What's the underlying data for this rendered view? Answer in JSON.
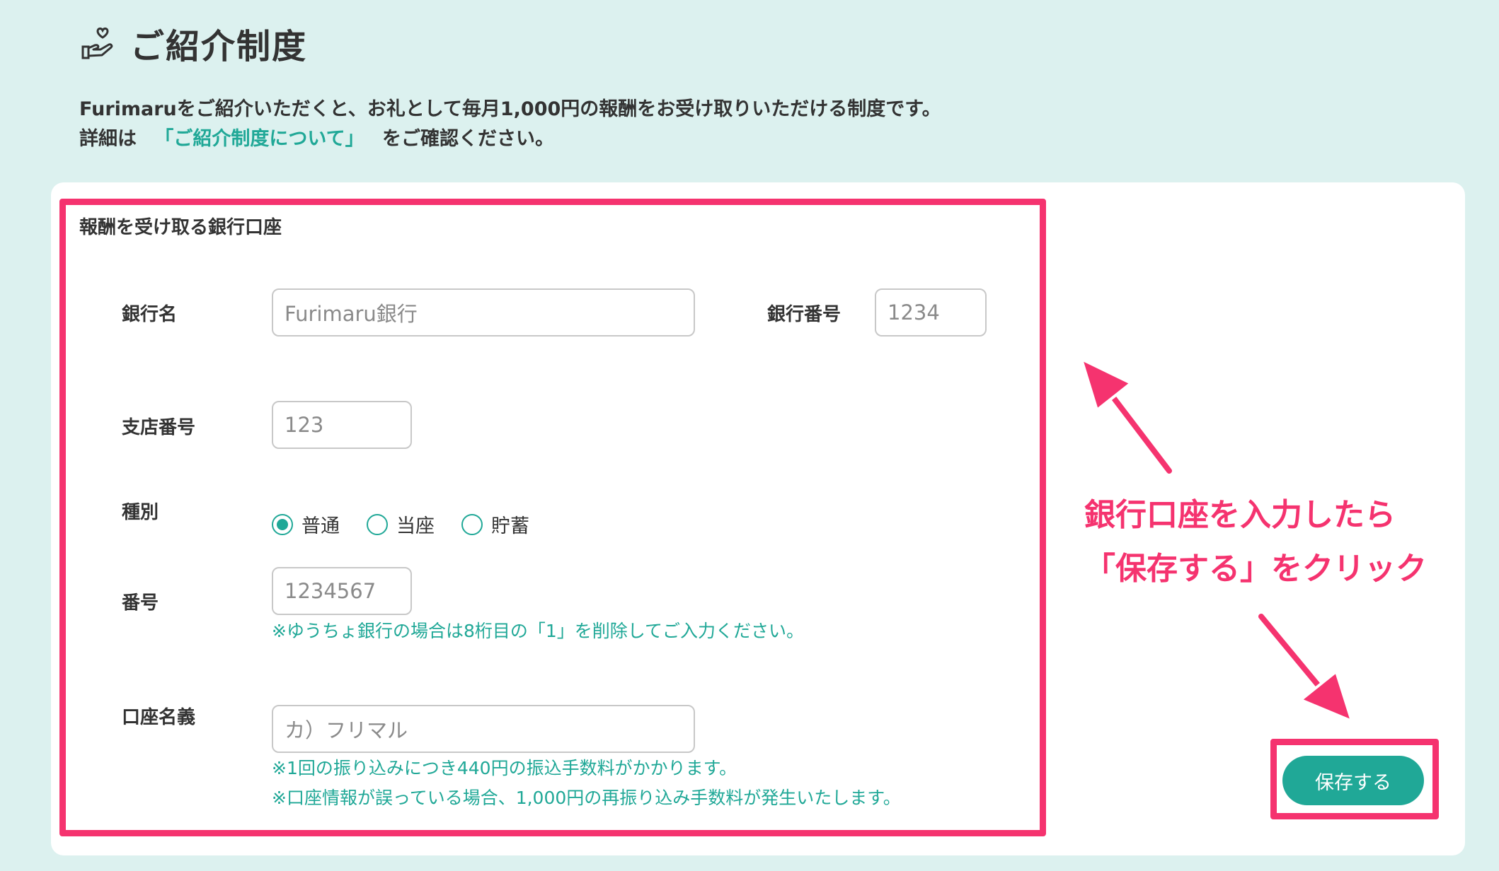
{
  "header": {
    "title": "ご紹介制度",
    "icon": "hand-heart-icon"
  },
  "intro": {
    "line1": "Furimaruをご紹介いただくと、お礼として毎月1,000円の報酬をお受け取りいただける制度です。",
    "line2_prefix": "詳細は",
    "line2_link": "「ご紹介制度について」",
    "line2_suffix": "をご確認ください。"
  },
  "form": {
    "section_title": "報酬を受け取る銀行口座",
    "bank_name": {
      "label": "銀行名",
      "placeholder": "Furimaru銀行"
    },
    "bank_code": {
      "label": "銀行番号",
      "placeholder": "1234"
    },
    "branch_code": {
      "label": "支店番号",
      "placeholder": "123"
    },
    "account_type": {
      "label": "種別",
      "options": [
        "普通",
        "当座",
        "貯蓄"
      ],
      "selected": "普通"
    },
    "account_number": {
      "label": "番号",
      "placeholder": "1234567",
      "note": "※ゆうちょ銀行の場合は8桁目の「1」を削除してご入力ください。"
    },
    "account_holder": {
      "label": "口座名義",
      "placeholder": "カ）フリマル",
      "note1": "※1回の振り込みにつき440円の振込手数料がかかります。",
      "note2": "※口座情報が誤っている場合、1,000円の再振り込み手数料が発生いたします。"
    },
    "save_label": "保存する"
  },
  "annotation": {
    "line1": "銀行口座を入力したら",
    "line2": "「保存する」をクリック"
  },
  "colors": {
    "background": "#dcf1ef",
    "accent": "#20a897",
    "highlight": "#f5336f"
  }
}
